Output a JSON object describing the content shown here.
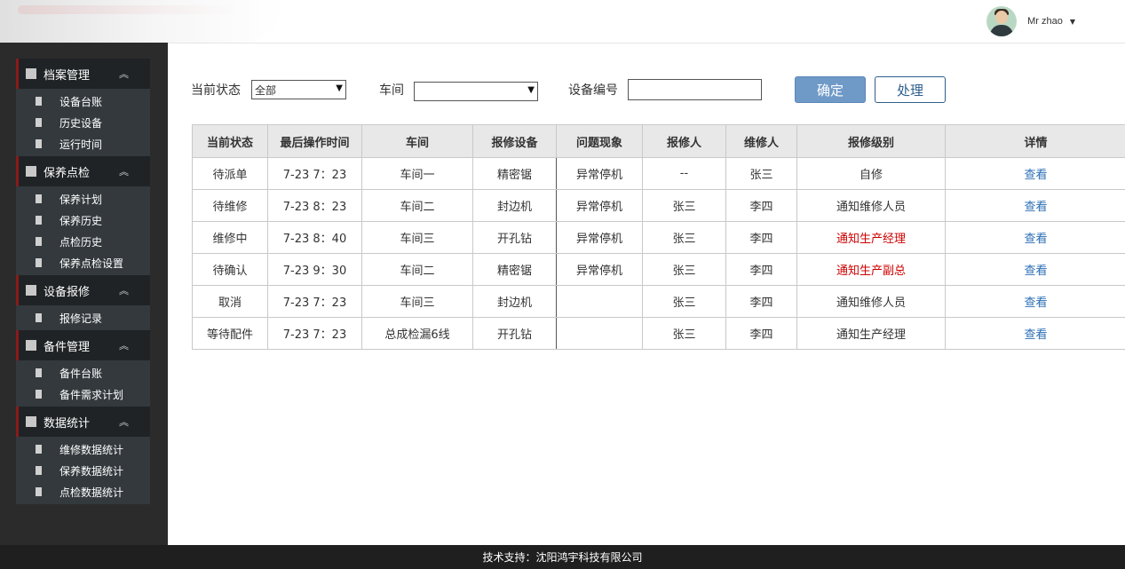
{
  "header": {
    "user_name": "Mr zhao",
    "caret": "▼"
  },
  "sidebar": {
    "groups": [
      {
        "title": "档案管理",
        "items": [
          "设备台账",
          "历史设备",
          "运行时间"
        ]
      },
      {
        "title": "保养点检",
        "items": [
          "保养计划",
          "保养历史",
          "点检历史",
          "保养点检设置"
        ]
      },
      {
        "title": "设备报修",
        "items": [
          "报修记录"
        ]
      },
      {
        "title": "备件管理",
        "items": [
          "备件台账",
          "备件需求计划"
        ]
      },
      {
        "title": "数据统计",
        "items": [
          "维修数据统计",
          "保养数据统计",
          "点检数据统计"
        ]
      }
    ],
    "collapse_glyph": "︽"
  },
  "filters": {
    "status_label": "当前状态",
    "status_value": "全部",
    "workshop_label": "车间",
    "workshop_value": "",
    "device_no_label": "设备编号",
    "device_no_value": "",
    "confirm_button": "确定",
    "process_button": "处理"
  },
  "table": {
    "headers": [
      "当前状态",
      "最后操作时间",
      "车间",
      "报修设备",
      "问题现象",
      "报修人",
      "维修人",
      "报修级别",
      "详情"
    ],
    "rows": [
      {
        "status": "待派单",
        "time": "7-23 7：23",
        "workshop": "车间一",
        "device": "精密锯",
        "problem": "异常停机",
        "reporter": "--",
        "repairer": "张三",
        "level": "自修",
        "level_color": "normal",
        "detail": "查看"
      },
      {
        "status": "待维修",
        "time": "7-23 8：23",
        "workshop": "车间二",
        "device": "封边机",
        "problem": "异常停机",
        "reporter": "张三",
        "repairer": "李四",
        "level": "通知维修人员",
        "level_color": "normal",
        "detail": "查看"
      },
      {
        "status": "维修中",
        "time": "7-23  8：40",
        "workshop": "车间三",
        "device": "开孔钻",
        "problem": "异常停机",
        "reporter": "张三",
        "repairer": "李四",
        "level": "通知生产经理",
        "level_color": "red",
        "detail": "查看"
      },
      {
        "status": "待确认",
        "time": "7-23 9：30",
        "workshop": "车间二",
        "device": "精密锯",
        "problem": "异常停机",
        "reporter": "张三",
        "repairer": "李四",
        "level": "通知生产副总",
        "level_color": "red",
        "detail": "查看"
      },
      {
        "status": "取消",
        "time": "7-23 7：23",
        "workshop": "车间三",
        "device": "封边机",
        "problem": "",
        "reporter": "张三",
        "repairer": "李四",
        "level": "通知维修人员",
        "level_color": "normal",
        "detail": "查看"
      },
      {
        "status": "等待配件",
        "time": "7-23 7：23",
        "workshop": "总成检漏6线",
        "device": "开孔钻",
        "problem": "",
        "reporter": "张三",
        "repairer": "李四",
        "level": "通知生产经理",
        "level_color": "normal",
        "detail": "查看"
      }
    ]
  },
  "footer": {
    "text": "技术支持：沈阳鸿宇科技有限公司"
  },
  "colors": {
    "accent_button": "#6f9ac8",
    "link": "#2a6db5",
    "alert": "#cc0000",
    "sidebar_bar": "#8b1a1a"
  },
  "icons": {
    "avatar": "user-avatar",
    "group_bullet": "square-icon",
    "item_bullet": "small-square-icon",
    "collapse": "chevron-double-up-icon",
    "dropdown": "chevron-down-icon"
  }
}
